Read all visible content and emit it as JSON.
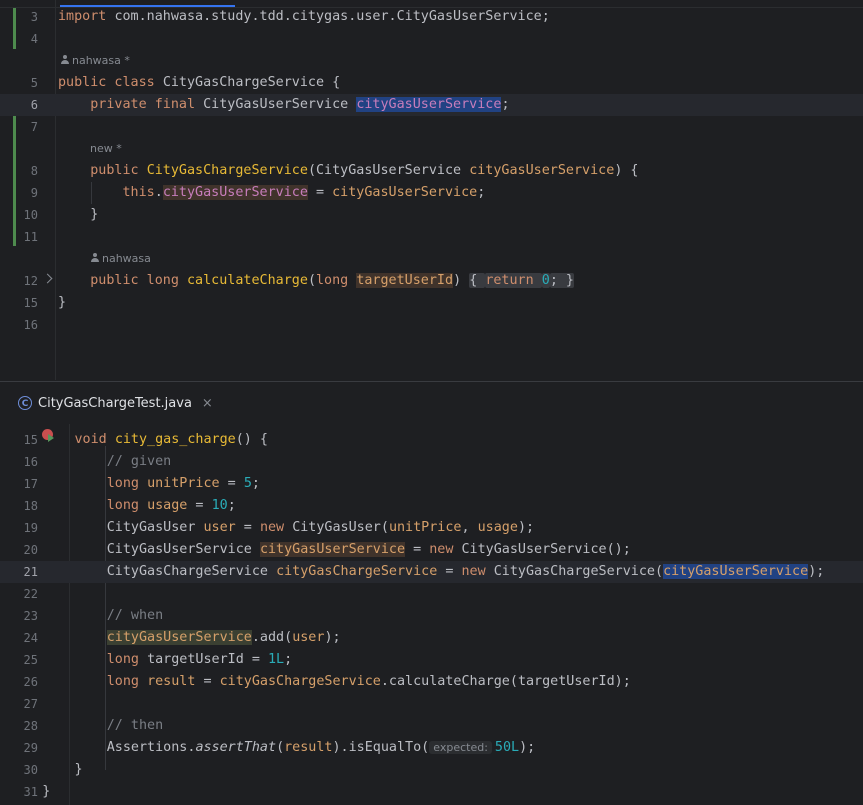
{
  "top_editor": {
    "lines": [
      {
        "num": "3",
        "tokens": [
          [
            "k",
            "import "
          ],
          [
            "plain",
            "com.nahwasa.study.tdd.citygas.user.CityGasUserService;"
          ]
        ]
      },
      {
        "num": "4",
        "tokens": []
      },
      {
        "num": "5",
        "tokens": [
          [
            "k",
            "public class "
          ],
          [
            "cls",
            "CityGasChargeService "
          ],
          [
            "plain",
            "{"
          ]
        ]
      },
      {
        "num": "6",
        "tokens": [
          [
            "plain",
            "    "
          ],
          [
            "k",
            "private final "
          ],
          [
            "cls",
            "CityGasUserService "
          ],
          [
            "fld sel",
            "cityGasUserService"
          ],
          [
            "plain",
            ";"
          ]
        ]
      },
      {
        "num": "7",
        "tokens": []
      },
      {
        "num": "8",
        "tokens": [
          [
            "plain",
            "    "
          ],
          [
            "k",
            "public "
          ],
          [
            "mdecl",
            "CityGasChargeService"
          ],
          [
            "plain",
            "("
          ],
          [
            "cls",
            "CityGasUserService "
          ],
          [
            "par",
            "cityGasUserService"
          ],
          [
            "plain",
            ") {"
          ]
        ]
      },
      {
        "num": "9",
        "tokens": [
          [
            "plain",
            "        "
          ],
          [
            "k",
            "this"
          ],
          [
            "plain",
            "."
          ],
          [
            "fld usage",
            "cityGasUserService"
          ],
          [
            "plain",
            " = "
          ],
          [
            "par",
            "cityGasUserService"
          ],
          [
            "plain",
            ";"
          ]
        ]
      },
      {
        "num": "10",
        "tokens": [
          [
            "plain",
            "    }"
          ]
        ]
      },
      {
        "num": "11",
        "tokens": []
      },
      {
        "num": "12",
        "tokens": [
          [
            "plain",
            "    "
          ],
          [
            "k",
            "public long "
          ],
          [
            "mdecl",
            "calculateCharge"
          ],
          [
            "plain",
            "("
          ],
          [
            "k",
            "long "
          ],
          [
            "par usage",
            "targetUserId"
          ],
          [
            "plain",
            ") "
          ],
          [
            "plain fold",
            "{ "
          ],
          [
            "k fold",
            "return "
          ],
          [
            "num fold",
            "0"
          ],
          [
            "plain fold",
            "; }"
          ]
        ]
      },
      {
        "num": "15",
        "tokens": [
          [
            "plain",
            "}"
          ]
        ]
      },
      {
        "num": "16",
        "tokens": []
      }
    ],
    "authors": {
      "class_author": "nahwasa *",
      "constructor_author": "new *",
      "method_author": "nahwasa"
    }
  },
  "tab": {
    "label": "CityGasChargeTest.java",
    "close_glyph": "×",
    "class_glyph": "C"
  },
  "bottom_editor": {
    "lines": [
      {
        "num": "15",
        "tokens": [
          [
            "plain",
            "        "
          ],
          [
            "k",
            "void "
          ],
          [
            "mdecl",
            "city_gas_charge"
          ],
          [
            "plain",
            "() {"
          ]
        ]
      },
      {
        "num": "16",
        "tokens": [
          [
            "plain",
            "            "
          ],
          [
            "cmt",
            "// given"
          ]
        ]
      },
      {
        "num": "17",
        "tokens": [
          [
            "plain",
            "            "
          ],
          [
            "k",
            "long "
          ],
          [
            "par",
            "unitPrice"
          ],
          [
            "plain",
            " = "
          ],
          [
            "num",
            "5"
          ],
          [
            "plain",
            ";"
          ]
        ]
      },
      {
        "num": "18",
        "tokens": [
          [
            "plain",
            "            "
          ],
          [
            "k",
            "long "
          ],
          [
            "par",
            "usage"
          ],
          [
            "plain",
            " = "
          ],
          [
            "num",
            "10"
          ],
          [
            "plain",
            ";"
          ]
        ]
      },
      {
        "num": "19",
        "tokens": [
          [
            "plain",
            "            "
          ],
          [
            "cls",
            "CityGasUser "
          ],
          [
            "par",
            "user"
          ],
          [
            "plain",
            " = "
          ],
          [
            "k",
            "new "
          ],
          [
            "cls",
            "CityGasUser("
          ],
          [
            "par",
            "unitPrice"
          ],
          [
            "plain",
            ", "
          ],
          [
            "par",
            "usage"
          ],
          [
            "plain",
            ");"
          ]
        ]
      },
      {
        "num": "20",
        "tokens": [
          [
            "plain",
            "            "
          ],
          [
            "cls",
            "CityGasUserService "
          ],
          [
            "par usage",
            "cityGasUserService"
          ],
          [
            "plain",
            " = "
          ],
          [
            "k",
            "new "
          ],
          [
            "cls",
            "CityGasUserService();"
          ]
        ]
      },
      {
        "num": "21",
        "tokens": [
          [
            "plain",
            "            "
          ],
          [
            "cls",
            "CityGasChargeService "
          ],
          [
            "par",
            "cityGasChargeService"
          ],
          [
            "plain",
            " = "
          ],
          [
            "k",
            "new "
          ],
          [
            "cls",
            "CityGasChargeService("
          ],
          [
            "par sel",
            "cityGasUserService"
          ],
          [
            "plain",
            ");"
          ]
        ]
      },
      {
        "num": "22",
        "tokens": []
      },
      {
        "num": "23",
        "tokens": [
          [
            "plain",
            "            "
          ],
          [
            "cmt",
            "// when"
          ]
        ]
      },
      {
        "num": "24",
        "tokens": [
          [
            "plain",
            "            "
          ],
          [
            "par usage-w",
            "cityGasUserService"
          ],
          [
            "plain",
            ".add("
          ],
          [
            "par",
            "user"
          ],
          [
            "plain",
            ");"
          ]
        ]
      },
      {
        "num": "25",
        "tokens": [
          [
            "plain",
            "            "
          ],
          [
            "k",
            "long "
          ],
          [
            "plain",
            "targetUserId = "
          ],
          [
            "num",
            "1L"
          ],
          [
            "plain",
            ";"
          ]
        ]
      },
      {
        "num": "26",
        "tokens": [
          [
            "plain",
            "            "
          ],
          [
            "k",
            "long "
          ],
          [
            "par",
            "result"
          ],
          [
            "plain",
            " = "
          ],
          [
            "par",
            "cityGasChargeService"
          ],
          [
            "plain",
            ".calculateCharge("
          ],
          [
            "plain",
            "targetUserId);"
          ]
        ]
      },
      {
        "num": "27",
        "tokens": []
      },
      {
        "num": "28",
        "tokens": [
          [
            "plain",
            "            "
          ],
          [
            "cmt",
            "// then"
          ]
        ]
      },
      {
        "num": "29",
        "tokens": [
          [
            "plain",
            "            Assertions."
          ],
          [
            "plain ital",
            "assertThat"
          ],
          [
            "plain",
            "("
          ],
          [
            "par",
            "result"
          ],
          [
            "plain",
            ").isEqualTo("
          ],
          [
            "hint",
            "expected:"
          ],
          [
            "num",
            "50L"
          ],
          [
            "plain",
            ");"
          ]
        ]
      },
      {
        "num": "30",
        "tokens": [
          [
            "plain",
            "        }"
          ]
        ]
      },
      {
        "num": "31",
        "tokens": [
          [
            "plain",
            "    }"
          ]
        ]
      }
    ]
  },
  "colors": {
    "background": "#1e1f22",
    "keyword": "#cf8e6d",
    "method_declaration": "#e8ba36",
    "field": "#c77dbb",
    "number": "#2aacb8",
    "comment": "#7a7e85",
    "selection": "#214283",
    "change_bar": "#4e8b4e"
  }
}
